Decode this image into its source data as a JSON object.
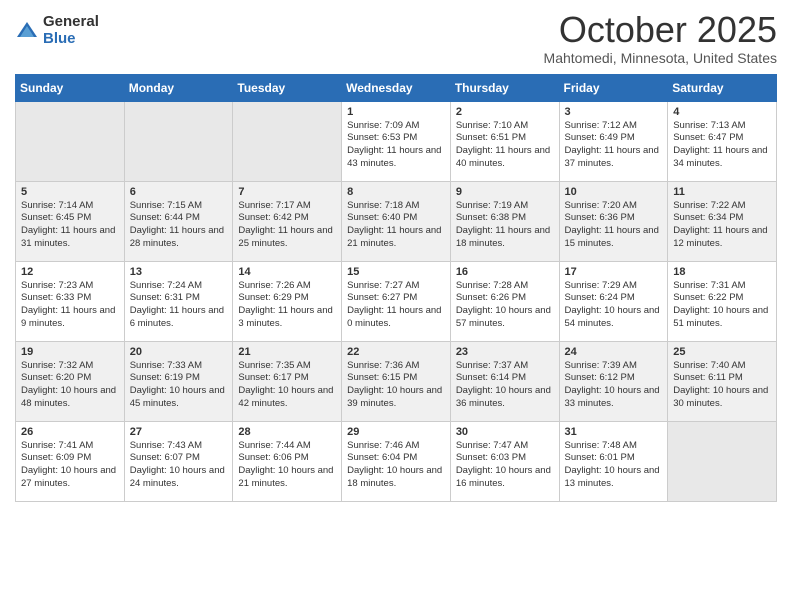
{
  "header": {
    "logo_general": "General",
    "logo_blue": "Blue",
    "title": "October 2025",
    "location": "Mahtomedi, Minnesota, United States"
  },
  "days_of_week": [
    "Sunday",
    "Monday",
    "Tuesday",
    "Wednesday",
    "Thursday",
    "Friday",
    "Saturday"
  ],
  "weeks": [
    [
      {
        "day": "",
        "content": ""
      },
      {
        "day": "",
        "content": ""
      },
      {
        "day": "",
        "content": ""
      },
      {
        "day": "1",
        "content": "Sunrise: 7:09 AM\nSunset: 6:53 PM\nDaylight: 11 hours and 43 minutes."
      },
      {
        "day": "2",
        "content": "Sunrise: 7:10 AM\nSunset: 6:51 PM\nDaylight: 11 hours and 40 minutes."
      },
      {
        "day": "3",
        "content": "Sunrise: 7:12 AM\nSunset: 6:49 PM\nDaylight: 11 hours and 37 minutes."
      },
      {
        "day": "4",
        "content": "Sunrise: 7:13 AM\nSunset: 6:47 PM\nDaylight: 11 hours and 34 minutes."
      }
    ],
    [
      {
        "day": "5",
        "content": "Sunrise: 7:14 AM\nSunset: 6:45 PM\nDaylight: 11 hours and 31 minutes."
      },
      {
        "day": "6",
        "content": "Sunrise: 7:15 AM\nSunset: 6:44 PM\nDaylight: 11 hours and 28 minutes."
      },
      {
        "day": "7",
        "content": "Sunrise: 7:17 AM\nSunset: 6:42 PM\nDaylight: 11 hours and 25 minutes."
      },
      {
        "day": "8",
        "content": "Sunrise: 7:18 AM\nSunset: 6:40 PM\nDaylight: 11 hours and 21 minutes."
      },
      {
        "day": "9",
        "content": "Sunrise: 7:19 AM\nSunset: 6:38 PM\nDaylight: 11 hours and 18 minutes."
      },
      {
        "day": "10",
        "content": "Sunrise: 7:20 AM\nSunset: 6:36 PM\nDaylight: 11 hours and 15 minutes."
      },
      {
        "day": "11",
        "content": "Sunrise: 7:22 AM\nSunset: 6:34 PM\nDaylight: 11 hours and 12 minutes."
      }
    ],
    [
      {
        "day": "12",
        "content": "Sunrise: 7:23 AM\nSunset: 6:33 PM\nDaylight: 11 hours and 9 minutes."
      },
      {
        "day": "13",
        "content": "Sunrise: 7:24 AM\nSunset: 6:31 PM\nDaylight: 11 hours and 6 minutes."
      },
      {
        "day": "14",
        "content": "Sunrise: 7:26 AM\nSunset: 6:29 PM\nDaylight: 11 hours and 3 minutes."
      },
      {
        "day": "15",
        "content": "Sunrise: 7:27 AM\nSunset: 6:27 PM\nDaylight: 11 hours and 0 minutes."
      },
      {
        "day": "16",
        "content": "Sunrise: 7:28 AM\nSunset: 6:26 PM\nDaylight: 10 hours and 57 minutes."
      },
      {
        "day": "17",
        "content": "Sunrise: 7:29 AM\nSunset: 6:24 PM\nDaylight: 10 hours and 54 minutes."
      },
      {
        "day": "18",
        "content": "Sunrise: 7:31 AM\nSunset: 6:22 PM\nDaylight: 10 hours and 51 minutes."
      }
    ],
    [
      {
        "day": "19",
        "content": "Sunrise: 7:32 AM\nSunset: 6:20 PM\nDaylight: 10 hours and 48 minutes."
      },
      {
        "day": "20",
        "content": "Sunrise: 7:33 AM\nSunset: 6:19 PM\nDaylight: 10 hours and 45 minutes."
      },
      {
        "day": "21",
        "content": "Sunrise: 7:35 AM\nSunset: 6:17 PM\nDaylight: 10 hours and 42 minutes."
      },
      {
        "day": "22",
        "content": "Sunrise: 7:36 AM\nSunset: 6:15 PM\nDaylight: 10 hours and 39 minutes."
      },
      {
        "day": "23",
        "content": "Sunrise: 7:37 AM\nSunset: 6:14 PM\nDaylight: 10 hours and 36 minutes."
      },
      {
        "day": "24",
        "content": "Sunrise: 7:39 AM\nSunset: 6:12 PM\nDaylight: 10 hours and 33 minutes."
      },
      {
        "day": "25",
        "content": "Sunrise: 7:40 AM\nSunset: 6:11 PM\nDaylight: 10 hours and 30 minutes."
      }
    ],
    [
      {
        "day": "26",
        "content": "Sunrise: 7:41 AM\nSunset: 6:09 PM\nDaylight: 10 hours and 27 minutes."
      },
      {
        "day": "27",
        "content": "Sunrise: 7:43 AM\nSunset: 6:07 PM\nDaylight: 10 hours and 24 minutes."
      },
      {
        "day": "28",
        "content": "Sunrise: 7:44 AM\nSunset: 6:06 PM\nDaylight: 10 hours and 21 minutes."
      },
      {
        "day": "29",
        "content": "Sunrise: 7:46 AM\nSunset: 6:04 PM\nDaylight: 10 hours and 18 minutes."
      },
      {
        "day": "30",
        "content": "Sunrise: 7:47 AM\nSunset: 6:03 PM\nDaylight: 10 hours and 16 minutes."
      },
      {
        "day": "31",
        "content": "Sunrise: 7:48 AM\nSunset: 6:01 PM\nDaylight: 10 hours and 13 minutes."
      },
      {
        "day": "",
        "content": ""
      }
    ]
  ]
}
